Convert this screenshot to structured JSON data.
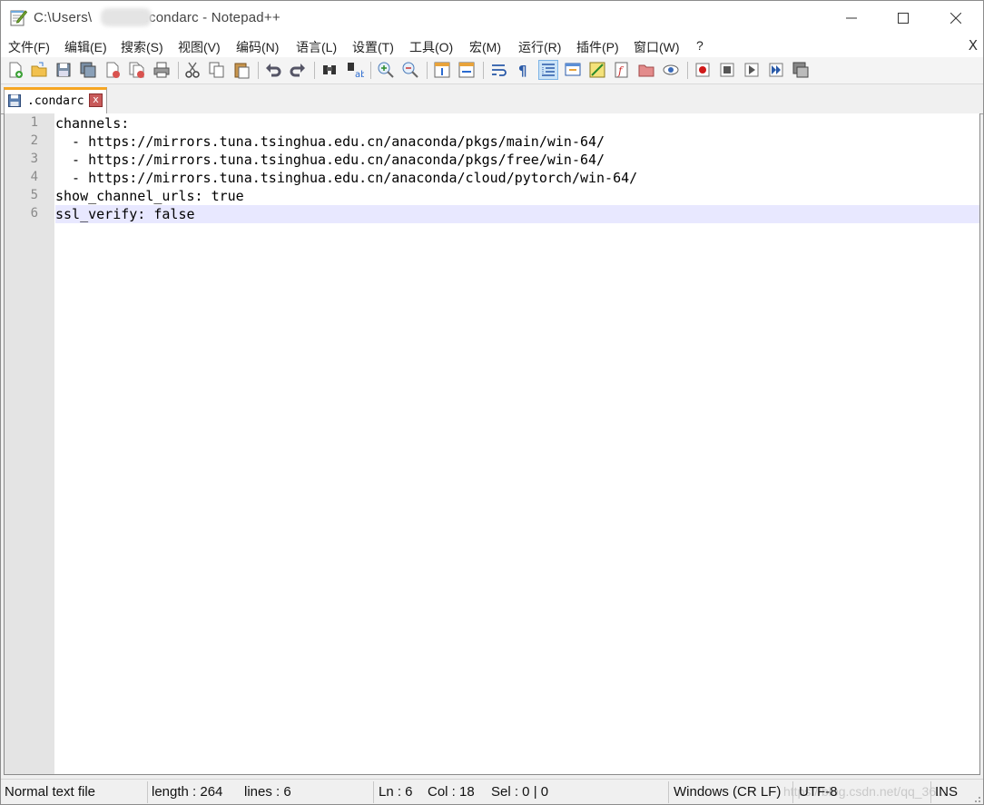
{
  "window": {
    "title_prefix": "C:\\Users\\",
    "title_suffix": "\\.condarc - Notepad++"
  },
  "menu": {
    "items": [
      "文件(F)",
      "编辑(E)",
      "搜索(S)",
      "视图(V)",
      "编码(N)",
      "语言(L)",
      "设置(T)",
      "工具(O)",
      "宏(M)",
      "运行(R)",
      "插件(P)",
      "窗口(W)",
      "?"
    ],
    "close_label": "X"
  },
  "tab": {
    "label": ".condarc",
    "close_glyph": "x"
  },
  "editor": {
    "line_numbers": [
      "1",
      "2",
      "3",
      "4",
      "5",
      "6"
    ],
    "lines": [
      "channels:",
      "  - https://mirrors.tuna.tsinghua.edu.cn/anaconda/pkgs/main/win-64/",
      "  - https://mirrors.tuna.tsinghua.edu.cn/anaconda/pkgs/free/win-64/",
      "  - https://mirrors.tuna.tsinghua.edu.cn/anaconda/cloud/pytorch/win-64/",
      "show_channel_urls: true",
      "ssl_verify: false"
    ],
    "current_line_number": 6,
    "current_line_highlight": "#e8e8ff"
  },
  "status": {
    "file_type": "Normal text file",
    "length": "length : 264",
    "lines": "lines : 6",
    "ln": "Ln : 6",
    "col": "Col : 18",
    "sel": "Sel : 0 | 0",
    "eol": "Windows (CR LF)",
    "encoding": "UTF-8",
    "mode": "INS",
    "watermark": "https://blog.csdn.net/qq_36..."
  },
  "colors": {
    "tab_accent": "#f6a623",
    "gutter": "#e4e4e4",
    "toolbar_active": "#cce4f7"
  }
}
